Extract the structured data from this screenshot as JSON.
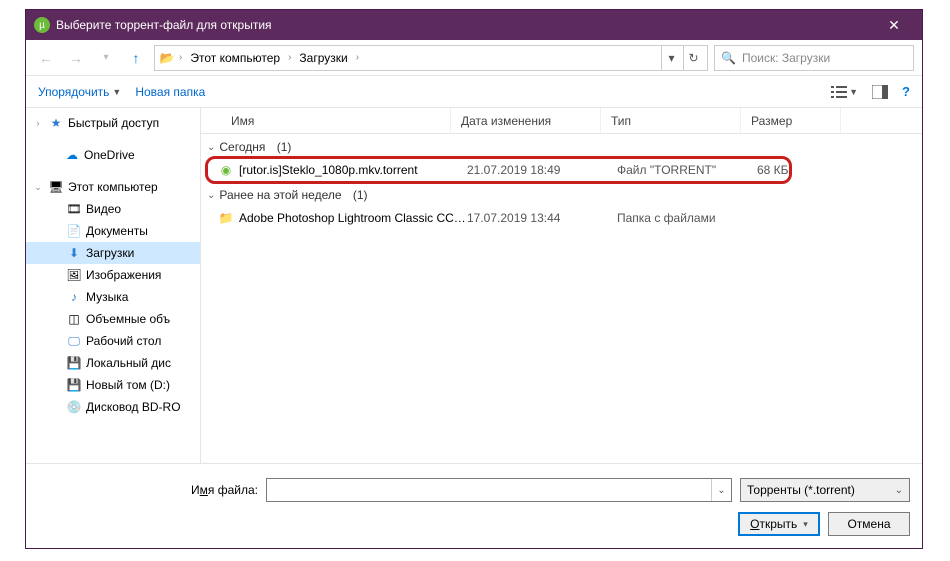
{
  "title": "Выберите торрент-файл для открытия",
  "breadcrumb": {
    "root": "Этот компьютер",
    "folder": "Загрузки"
  },
  "search": {
    "placeholder": "Поиск: Загрузки"
  },
  "toolbar": {
    "organize": "Упорядочить",
    "newfolder": "Новая папка"
  },
  "sidebar": {
    "quick": "Быстрый доступ",
    "onedrive": "OneDrive",
    "pc": "Этот компьютер",
    "videos": "Видео",
    "documents": "Документы",
    "downloads": "Загрузки",
    "pictures": "Изображения",
    "music": "Музыка",
    "volumes": "Объемные объ",
    "desktop": "Рабочий стол",
    "localdisk": "Локальный дис",
    "newvol": "Новый том (D:)",
    "bdrom": "Дисковод BD-RO"
  },
  "columns": {
    "name": "Имя",
    "date": "Дата изменения",
    "type": "Тип",
    "size": "Размер"
  },
  "groups": {
    "today": {
      "label": "Сегодня",
      "count": "(1)"
    },
    "earlier": {
      "label": "Ранее на этой неделе",
      "count": "(1)"
    }
  },
  "files": {
    "f1": {
      "name": "[rutor.is]Steklo_1080p.mkv.torrent",
      "date": "21.07.2019 18:49",
      "type": "Файл \"TORRENT\"",
      "size": "68 КБ"
    },
    "f2": {
      "name": "Adobe Photoshop Lightroom Classic CC ...",
      "date": "17.07.2019 13:44",
      "type": "Папка с файлами",
      "size": ""
    }
  },
  "footer": {
    "filename_label_pre": "И",
    "filename_label_ul": "м",
    "filename_label_post": "я файла:",
    "filter": "Торренты (*.torrent)",
    "open_ul": "О",
    "open_post": "ткрыть",
    "cancel": "Отмена"
  }
}
